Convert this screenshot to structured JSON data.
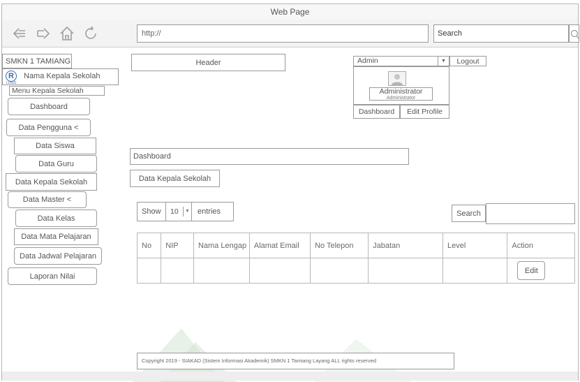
{
  "window": {
    "title": "Web Page"
  },
  "browser": {
    "url": "http://",
    "search": "Search",
    "icons": [
      "back-arrow-icon",
      "forward-arrow-icon",
      "home-icon",
      "refresh-icon",
      "magnifier-icon"
    ]
  },
  "sidebar": {
    "school": "SMKN 1 TAMIANG",
    "principal_name": "Nama Kepala Sekolah",
    "menu_title": "Menu Kepala Sekolah",
    "items": {
      "dashboard": "Dashboard",
      "data_pengguna": "Data Pengguna <",
      "data_siswa": "Data Siswa",
      "data_guru": "Data Guru",
      "data_kepala_sekolah": "Data Kepala Sekolah",
      "data_master": "Data Master <",
      "data_kelas": "Data Kelas",
      "data_mata_pelajaran": "Data Mata Pelajaran",
      "data_jadwal_pelajaran": "Data Jadwal Pelajaran",
      "laporan_nilai": "Laporan Nilai"
    }
  },
  "header": {
    "label": "Header",
    "user_select": "Admin",
    "logout": "Logout",
    "profile_name": "Administrator",
    "profile_role": "Administrator",
    "dashboard_btn": "Dashboard",
    "edit_profile_btn": "Edit Profile"
  },
  "main": {
    "breadcrumb": "Dashboard",
    "page_title": "Data Kepala Sekolah",
    "show_label": "Show",
    "entries_value": "10",
    "entries_label": "entries",
    "search_label": "Search",
    "table": {
      "columns": [
        "No",
        "NIP",
        "Nama Lengap",
        "Alamat Email",
        "No Telepon",
        "Jabatan",
        "Level",
        "Action"
      ],
      "rows": [
        {
          "action": "Edit"
        }
      ]
    }
  },
  "footer": {
    "copyright": "Copyright 2019 - SIAKAD (Sistem Informasi Akademik) SMKN 1 Tamiang Layang ALL rights reserved"
  }
}
